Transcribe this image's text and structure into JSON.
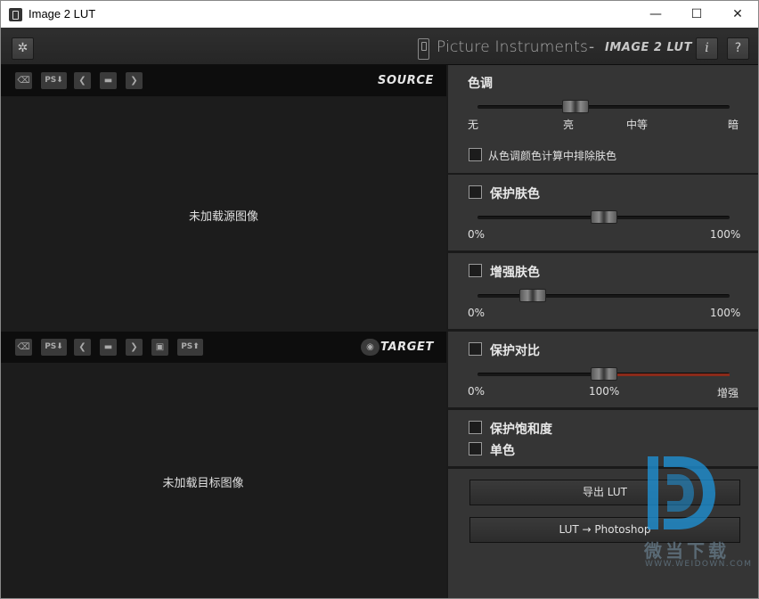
{
  "window": {
    "title": "Image 2 LUT",
    "minimize": "—",
    "maximize": "☐",
    "close": "✕"
  },
  "header": {
    "settings_icon": "gear-icon",
    "brand_name": "Picture Instruments",
    "brand_separator": "-",
    "product_name": "IMAGE 2 LUT",
    "info_label": "i",
    "help_label": "?"
  },
  "source": {
    "label": "SOURCE",
    "empty_message": "未加载源图像",
    "toolbar": {
      "ps_import": "PS⬇",
      "prev": "❮",
      "next": "❯"
    }
  },
  "target": {
    "label": "TARGET",
    "empty_message": "未加载目标图像",
    "toolbar": {
      "ps_import": "PS⬇",
      "prev": "❮",
      "next": "❯",
      "ps_export": "PS⬆"
    }
  },
  "controls": {
    "tone": {
      "title": "色调",
      "value": 0.39,
      "scale": [
        "无",
        "亮",
        "中等",
        "暗"
      ],
      "exclude_label": "从色调颜色计算中排除肤色",
      "exclude_checked": false
    },
    "protect_skin": {
      "title": "保护肤色",
      "checked": false,
      "value": 0.5,
      "min_label": "0%",
      "max_label": "100%"
    },
    "enhance_skin": {
      "title": "增强肤色",
      "checked": false,
      "value": 0.22,
      "min_label": "0%",
      "max_label": "100%"
    },
    "protect_contrast": {
      "title": "保护对比",
      "checked": false,
      "value": 0.5,
      "min_label": "0%",
      "mid_label": "100%",
      "max_label": "增强"
    },
    "protect_saturation": {
      "title": "保护饱和度",
      "checked": false
    },
    "monochrome": {
      "title": "单色",
      "checked": false
    }
  },
  "actions": {
    "export_lut": "导出 LUT",
    "lut_to_photoshop": "LUT → Photoshop"
  },
  "watermark": {
    "text": "微当下载",
    "sub": "WWW.WEIDOWN.COM"
  },
  "colors": {
    "accent_red": "#8a2a1a",
    "panel_bg": "#353535",
    "image_bg": "#1c1c1c"
  }
}
